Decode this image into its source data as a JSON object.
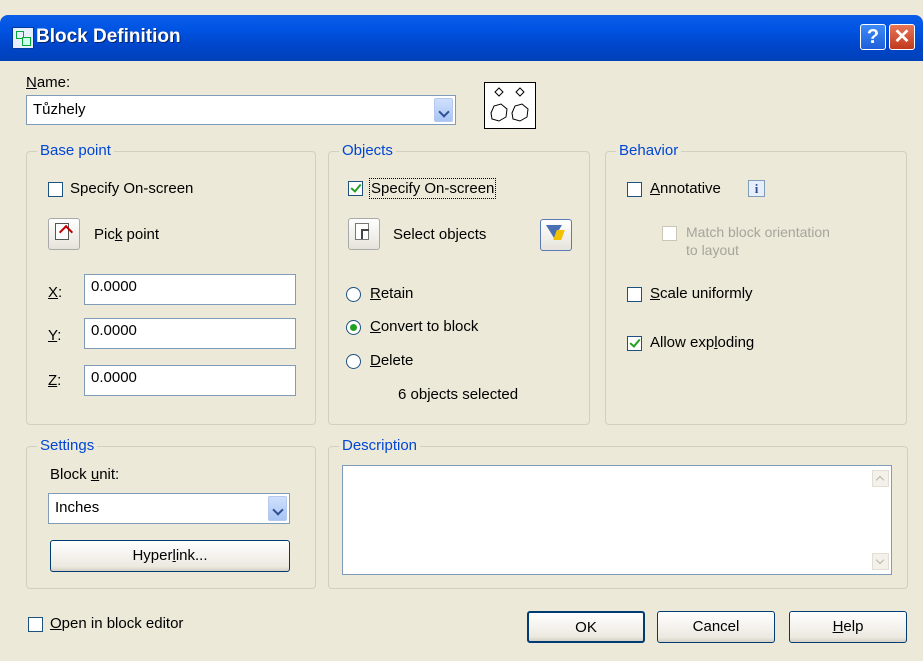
{
  "window": {
    "title": "Block Definition"
  },
  "name": {
    "label": "Name:",
    "value": "Tůzhely"
  },
  "base_point": {
    "title": "Base point",
    "specify_label": "Specify On-screen",
    "specify_checked": false,
    "pick_label": "Pick point",
    "x_label": "X:",
    "x_value": "0.0000",
    "y_label": "Y:",
    "y_value": "0.0000",
    "z_label": "Z:",
    "z_value": "0.0000"
  },
  "objects": {
    "title": "Objects",
    "specify_label": "Specify On-screen",
    "specify_checked": true,
    "select_label": "Select objects",
    "retain_label": "Retain",
    "convert_label": "Convert to block",
    "delete_label": "Delete",
    "selected_option": "Convert to block",
    "status": "6 objects selected"
  },
  "behavior": {
    "title": "Behavior",
    "annotative_label": "Annotative",
    "annotative_checked": false,
    "match_label_1": "Match block orientation",
    "match_label_2": "to layout",
    "scale_label": "Scale uniformly",
    "scale_checked": false,
    "explode_label": "Allow exploding",
    "explode_checked": true
  },
  "settings": {
    "title": "Settings",
    "unit_label": "Block unit:",
    "unit_value": "Inches",
    "hyperlink_label": "Hyperlink..."
  },
  "description": {
    "title": "Description",
    "value": ""
  },
  "footer": {
    "open_editor_label": "Open in block editor",
    "open_editor_checked": false,
    "ok_label": "OK",
    "cancel_label": "Cancel",
    "help_label": "Help"
  },
  "colors": {
    "titlebar": "#0054e3",
    "dialog_bg": "#ece9d8",
    "group_title": "#0046d5",
    "check_mark": "#21a121"
  }
}
